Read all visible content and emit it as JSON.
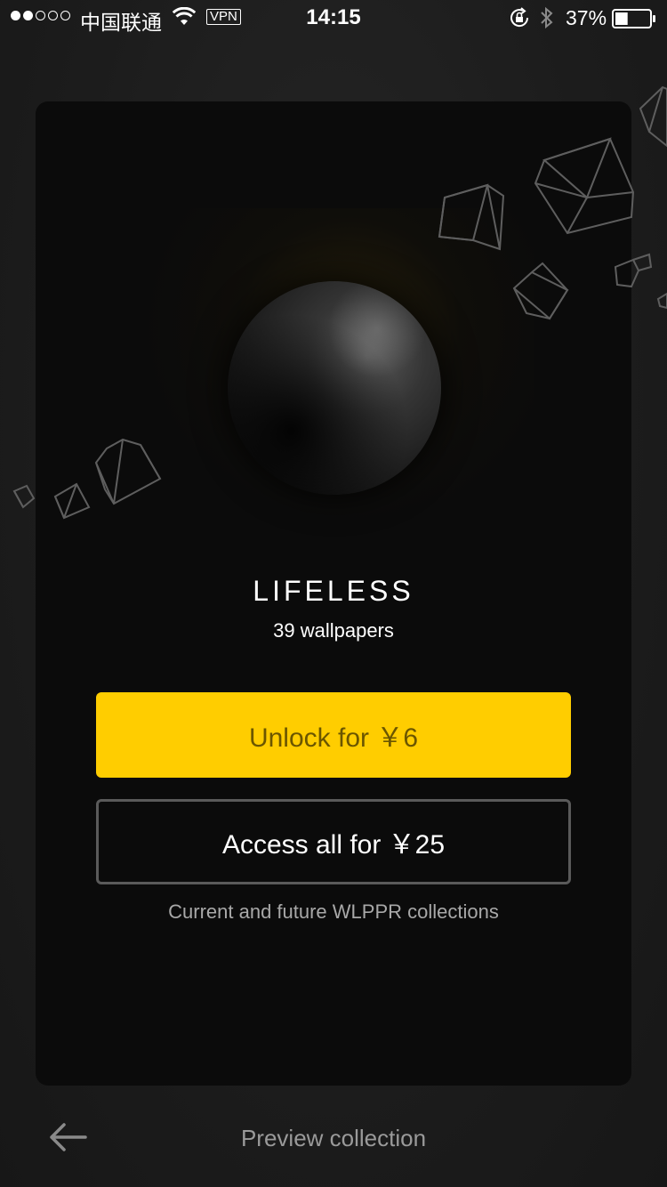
{
  "status_bar": {
    "carrier": "中国联通",
    "vpn": "VPN",
    "time": "14:15",
    "battery_percent": "37%",
    "battery_level": 0.37,
    "signal_filled": 2,
    "signal_total": 5,
    "icons": [
      "wifi-icon",
      "rotation-lock-icon",
      "bluetooth-icon",
      "battery-icon"
    ]
  },
  "collection": {
    "title": "LIFELESS",
    "count_label": "39 wallpapers"
  },
  "actions": {
    "unlock_label": "Unlock for ￥6",
    "access_all_label": "Access all for ￥25",
    "access_note": "Current and future WLPPR collections"
  },
  "bottom_bar": {
    "back_icon": "arrow-left-icon",
    "preview_label": "Preview collection"
  },
  "colors": {
    "accent": "#ffcd00",
    "unlock_text": "#6b5600",
    "card_bg": "#0b0b0b",
    "screen_bg": "#1c1c1c"
  }
}
